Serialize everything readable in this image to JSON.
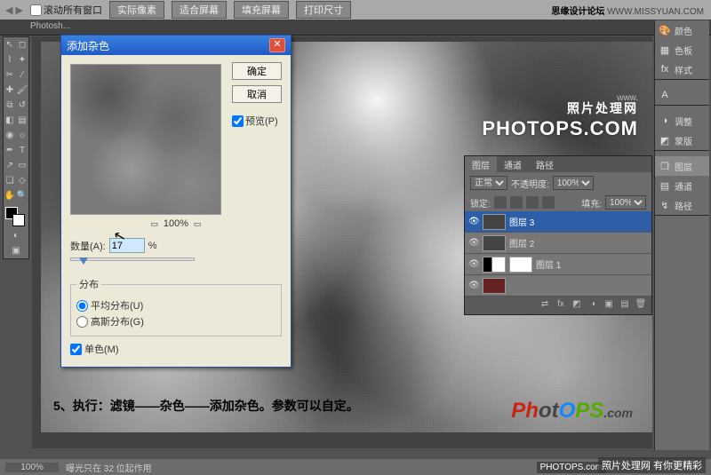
{
  "header": {
    "scroll_all": "滚动所有窗口",
    "buttons": [
      "实际像素",
      "适合屏幕",
      "填充屏幕",
      "打印尺寸"
    ],
    "site_label": "思缘设计论坛",
    "site_url": "WWW.MISSYUAN.COM"
  },
  "tabbar": {
    "tab": "Photosh..."
  },
  "dialog": {
    "title": "添加杂色",
    "ok": "确定",
    "cancel": "取消",
    "preview_label": "预览(P)",
    "zoom": "100%",
    "amount_label": "数量(A):",
    "amount_value": "17",
    "amount_pct": "%",
    "dist_legend": "分布",
    "uniform": "平均分布(U)",
    "gaussian": "高斯分布(G)",
    "mono": "单色(M)"
  },
  "canvas": {
    "watermark_top_small": "www.",
    "watermark_top_cn": "照片处理网",
    "watermark_top_big": "PHOTOPS.COM",
    "caption": "5、执行：滤镜——杂色——添加杂色。参数可以自定。",
    "wm2_p1": "Ph",
    "wm2_p2": "ot",
    "wm2_p3": "O",
    "wm2_p4": "PS",
    "wm2_p5": ".com"
  },
  "right_panels": {
    "items": [
      "颜色",
      "色板",
      "样式",
      "调整",
      "蒙版",
      "图层",
      "通道",
      "路径"
    ],
    "active": "图层"
  },
  "layers": {
    "tabs": [
      "图层",
      "通道",
      "路径"
    ],
    "blend": "正常",
    "opacity_label": "不透明度:",
    "opacity": "100%",
    "lock_label": "锁定:",
    "fill_label": "填充:",
    "fill": "100%",
    "rows": [
      {
        "name": "图层 3",
        "selected": true
      },
      {
        "name": "图层 2",
        "selected": false
      },
      {
        "name": "图层 1",
        "selected": false
      }
    ]
  },
  "status": {
    "zoom": "100%",
    "info": "曝光只在 32 位起作用"
  },
  "footer": {
    "brand1": "照片处理网 有你更精彩",
    "brand2": "PHOTOPS.com"
  },
  "icons": {
    "color": "🎨",
    "swatch": "▦",
    "style": "fx",
    "adjust": "◑",
    "mask": "◩",
    "layers": "❐",
    "channels": "▤",
    "paths": "↯",
    "type": "A"
  }
}
